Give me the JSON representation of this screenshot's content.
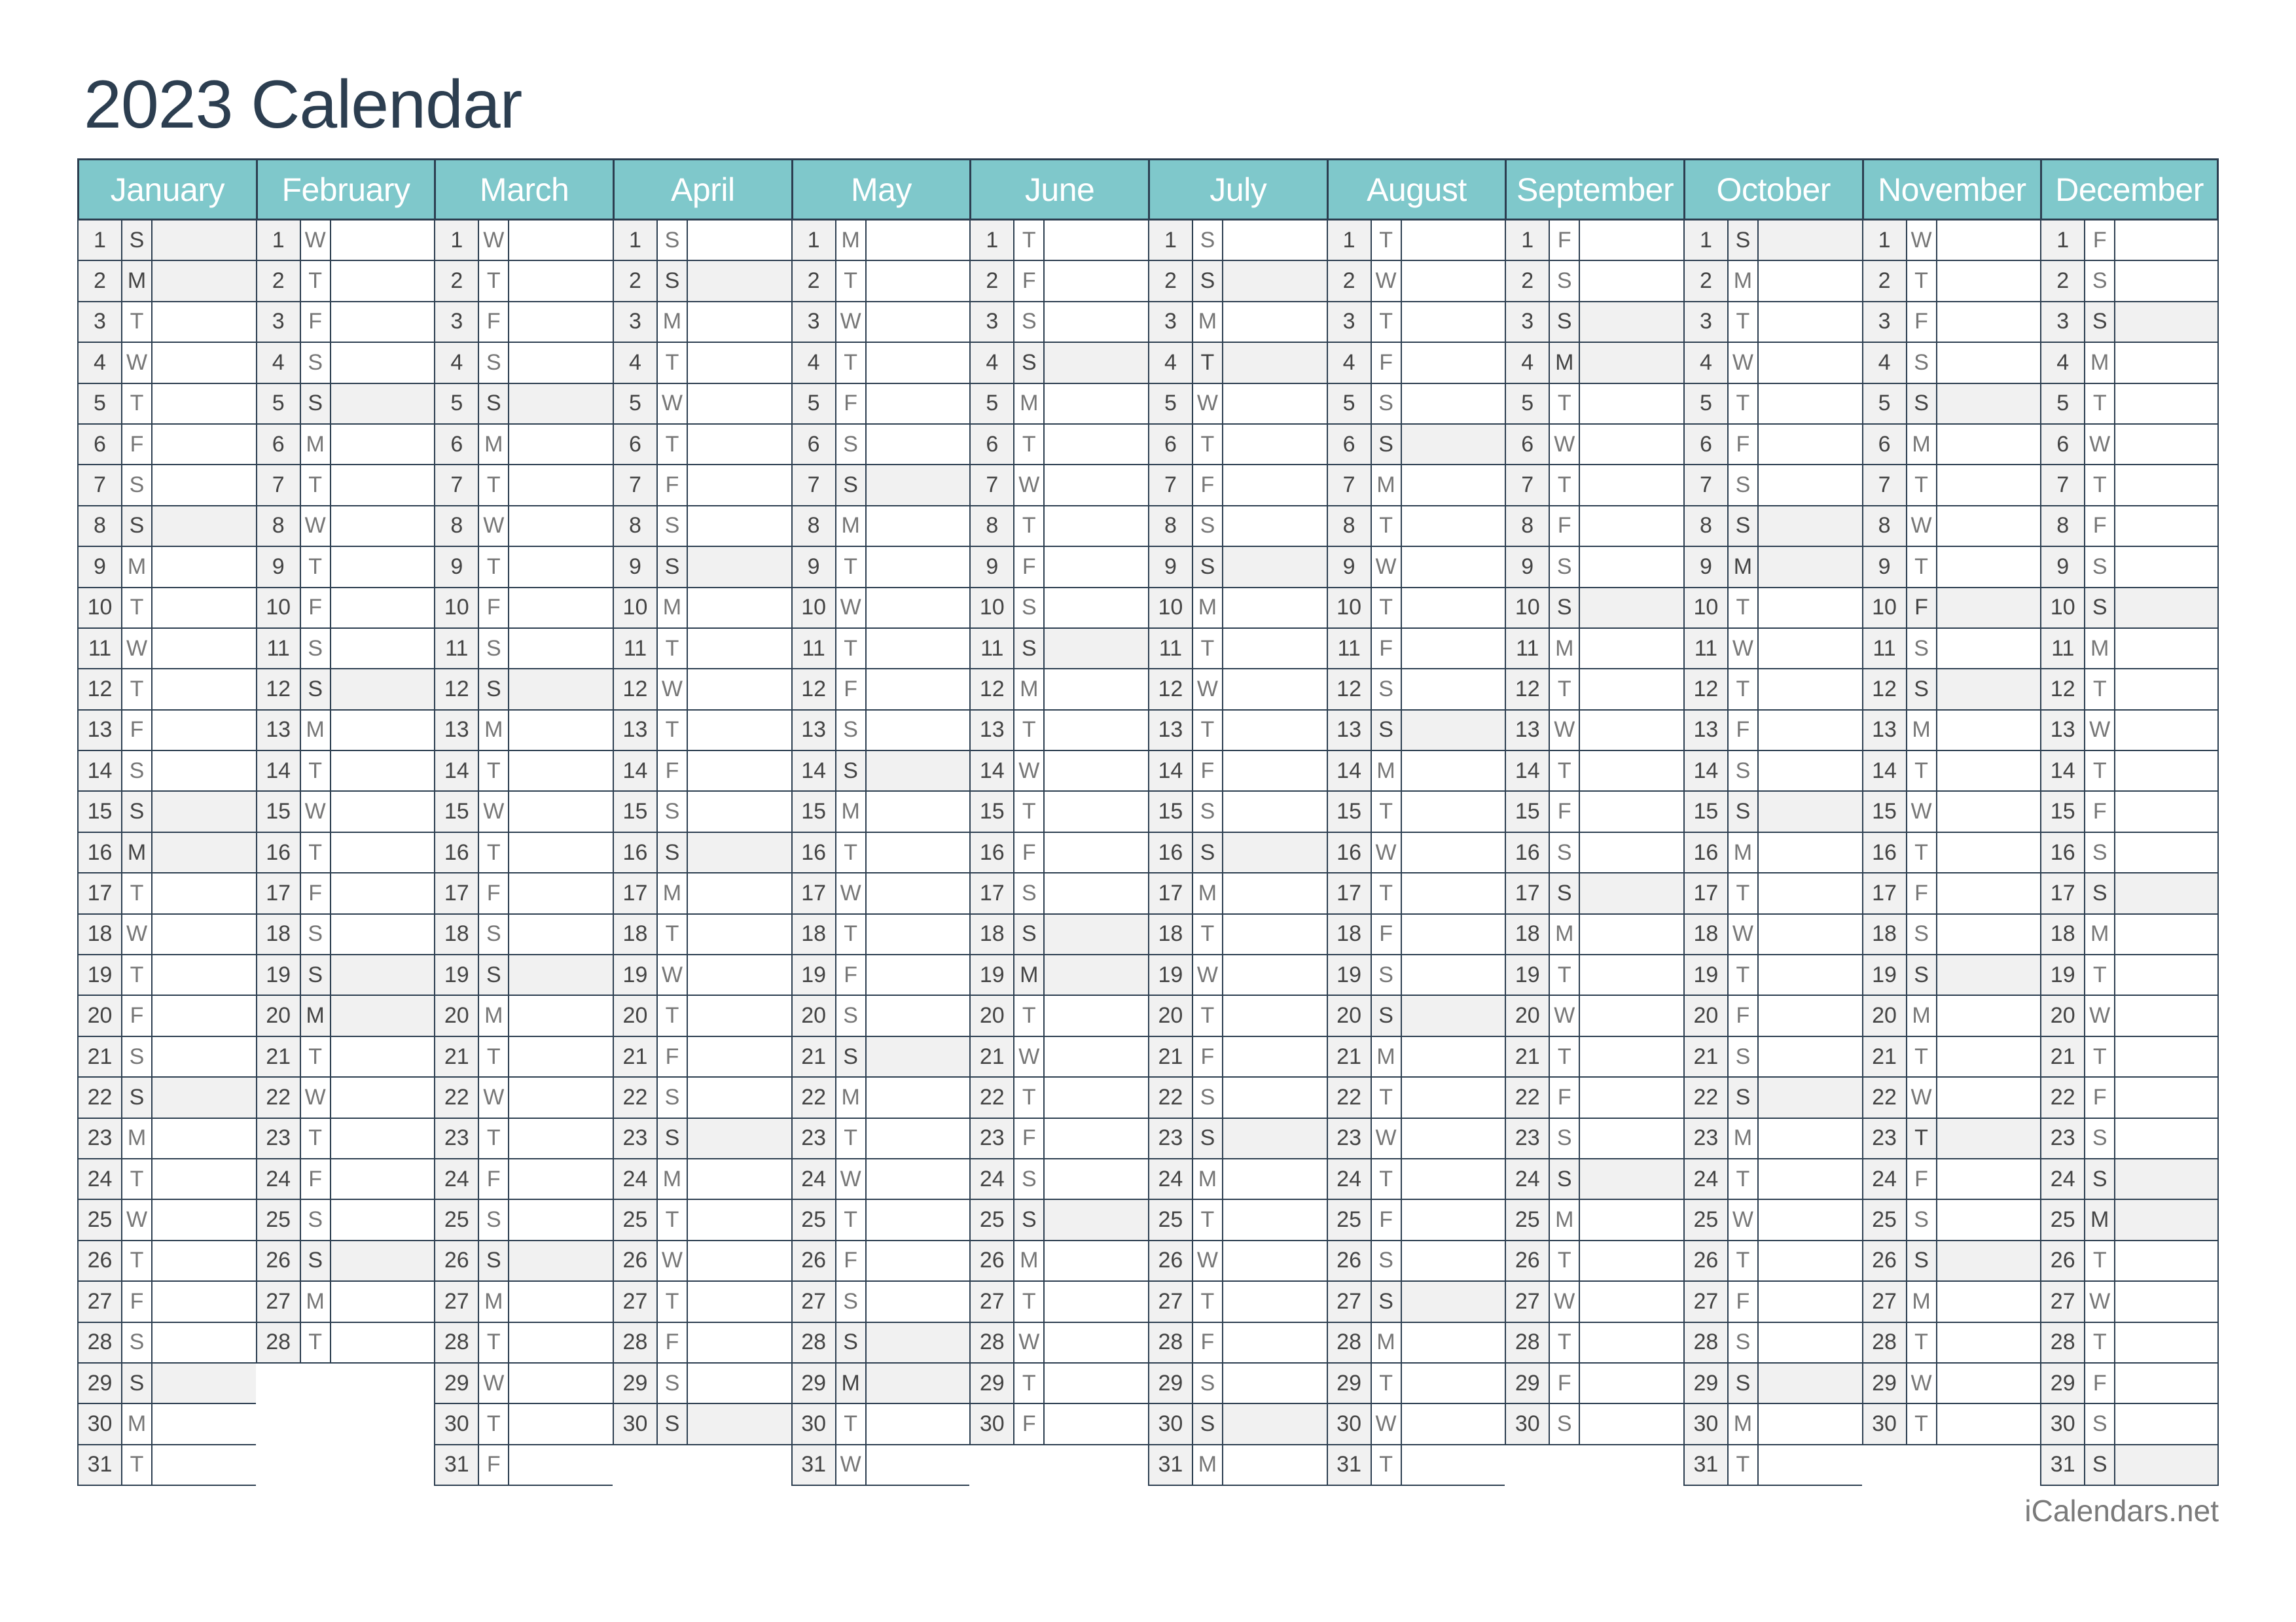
{
  "title": "2023 Calendar",
  "footer": "iCalendars.net",
  "colors": {
    "header_bg": "#7fc8cb",
    "border": "#2c3e50",
    "shade": "#f1f1f1",
    "title": "#2c3e50"
  },
  "year": 2023,
  "weekday_letters": [
    "S",
    "M",
    "T",
    "W",
    "T",
    "F",
    "S"
  ],
  "holidays": [
    "1-2",
    "1-16",
    "2-20",
    "5-29",
    "6-19",
    "7-4",
    "9-4",
    "10-9",
    "11-10",
    "11-23",
    "12-25"
  ],
  "months": [
    {
      "name": "January",
      "days": 31,
      "first_dow": 0
    },
    {
      "name": "February",
      "days": 28,
      "first_dow": 3
    },
    {
      "name": "March",
      "days": 31,
      "first_dow": 3
    },
    {
      "name": "April",
      "days": 30,
      "first_dow": 6
    },
    {
      "name": "May",
      "days": 31,
      "first_dow": 1
    },
    {
      "name": "June",
      "days": 30,
      "first_dow": 4
    },
    {
      "name": "July",
      "days": 31,
      "first_dow": 6
    },
    {
      "name": "August",
      "days": 31,
      "first_dow": 2
    },
    {
      "name": "September",
      "days": 30,
      "first_dow": 5
    },
    {
      "name": "October",
      "days": 31,
      "first_dow": 0
    },
    {
      "name": "November",
      "days": 30,
      "first_dow": 3
    },
    {
      "name": "December",
      "days": 31,
      "first_dow": 5
    }
  ]
}
